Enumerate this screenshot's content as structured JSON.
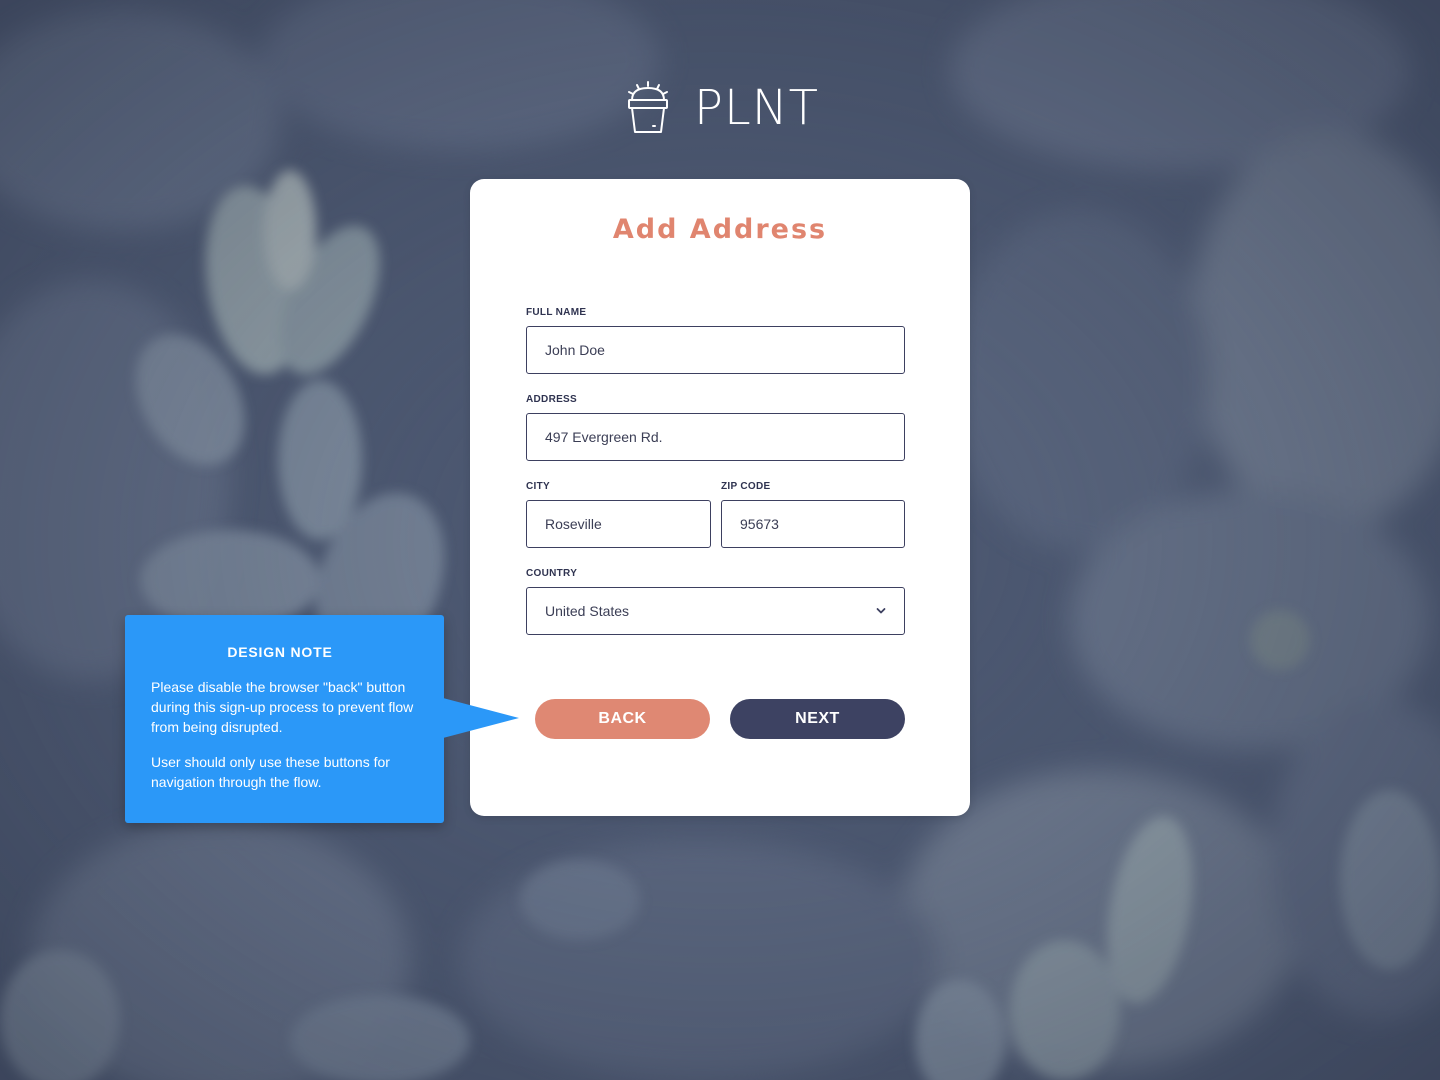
{
  "brand": {
    "name": "PLNT",
    "icon": "plant-pot-icon"
  },
  "form": {
    "title": "Add Address",
    "fields": {
      "full_name": {
        "label": "FULL NAME",
        "value": "John Doe"
      },
      "address": {
        "label": "ADDRESS",
        "value": "497 Evergreen Rd."
      },
      "city": {
        "label": "CITY",
        "value": "Roseville"
      },
      "zip": {
        "label": "ZIP CODE",
        "value": "95673"
      },
      "country": {
        "label": "COUNTRY",
        "value": "United States",
        "icon": "chevron-down-icon"
      }
    },
    "buttons": {
      "back": "BACK",
      "next": "NEXT"
    }
  },
  "design_note": {
    "title": "DESIGN NOTE",
    "paragraphs": [
      "Please disable the browser \"back\" button during this sign-up process to prevent flow from being disrupted.",
      "User should only use these buttons for navigation through the flow."
    ]
  },
  "colors": {
    "accent": "#e0856f",
    "primary": "#3d4262",
    "note": "#2b98f8",
    "background": "#4f5c74"
  }
}
